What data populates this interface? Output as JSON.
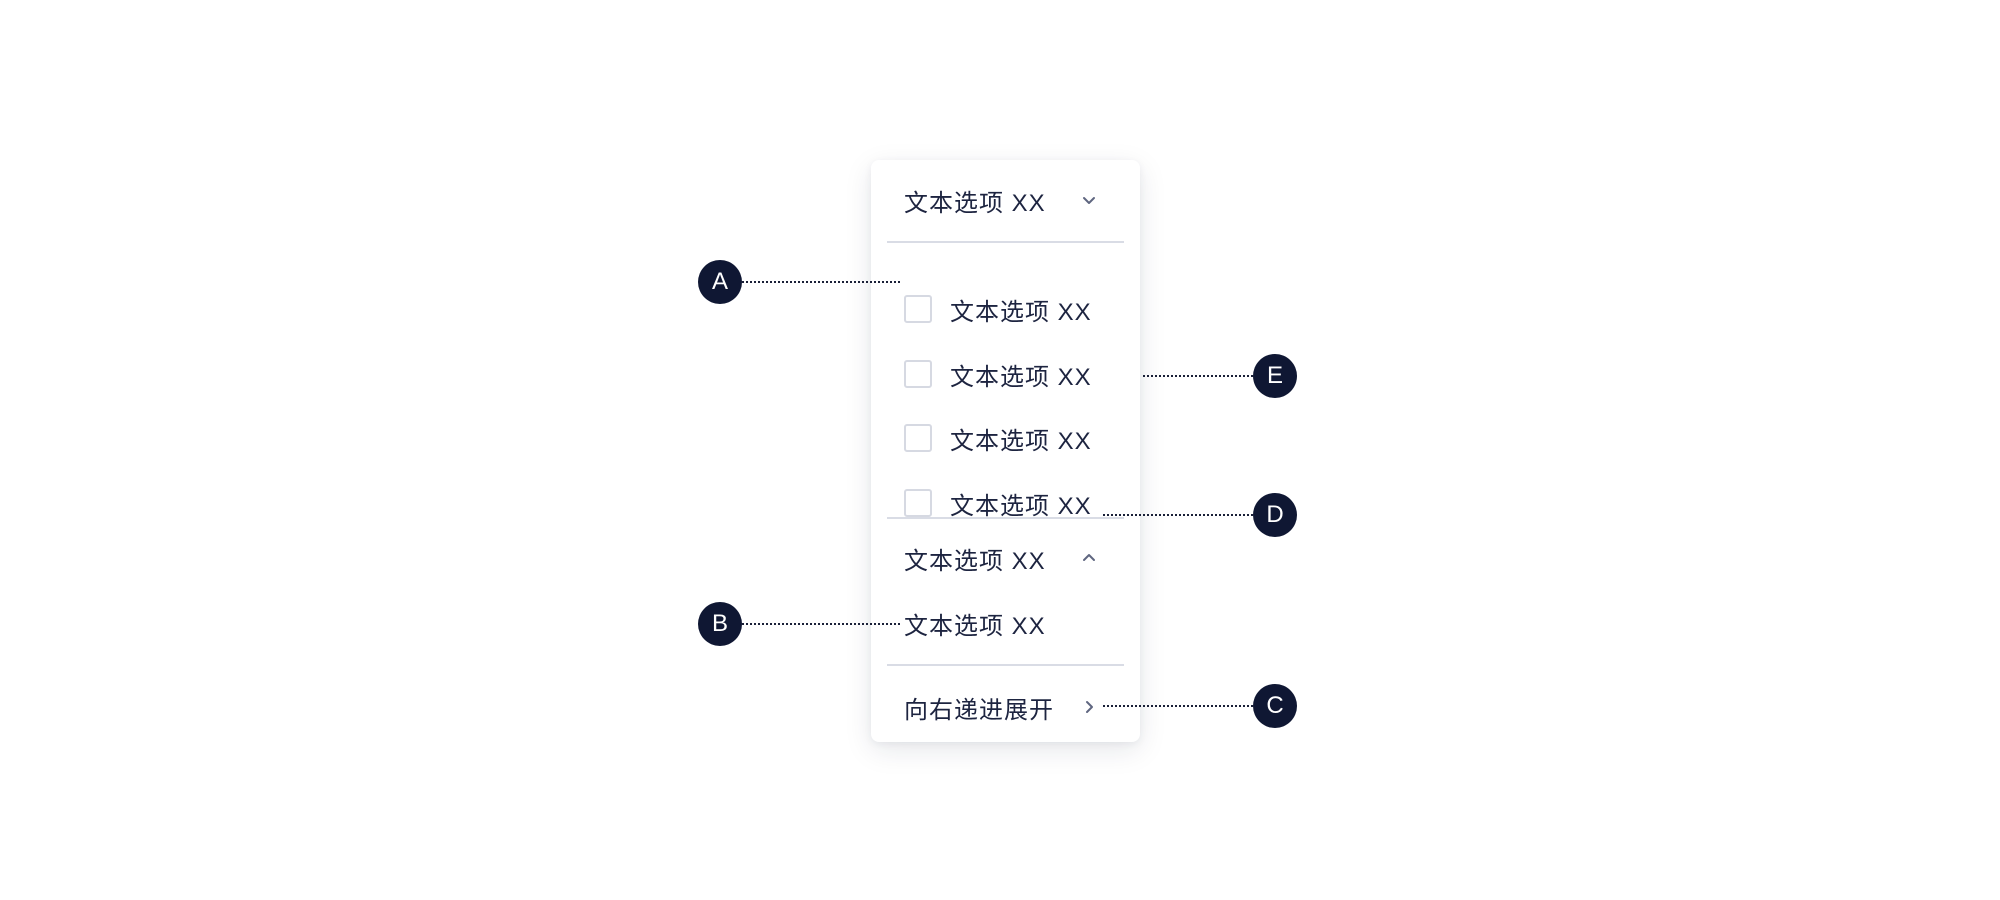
{
  "menu": {
    "group_1": {
      "header_label": "文本选项  XX",
      "header_icon": "chevron-down-icon",
      "items": [
        {
          "label": "文本选项  XX",
          "checked": false
        },
        {
          "label": "文本选项  XX",
          "checked": false
        },
        {
          "label": "文本选项  XX",
          "checked": false
        },
        {
          "label": "文本选项  XX",
          "checked": false
        }
      ]
    },
    "group_2": {
      "header_label": "文本选项  XX",
      "header_icon": "chevron-up-icon",
      "items": [
        {
          "label": "文本选项  XX"
        }
      ]
    },
    "cascade_item": {
      "label": "向右递进展开",
      "icon": "chevron-right-icon"
    }
  },
  "callouts": {
    "a": "A",
    "b": "B",
    "c": "C",
    "d": "D",
    "e": "E"
  },
  "colors": {
    "text": "#1d2440",
    "divider": "#d9dce5",
    "checkbox_border": "#d6d9e2",
    "badge_bg": "#0f1733",
    "badge_text": "#ffffff",
    "chevron": "#5f6680"
  }
}
